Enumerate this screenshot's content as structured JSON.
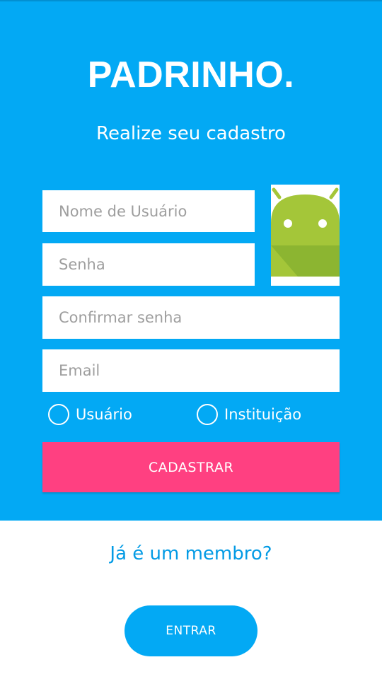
{
  "header": {
    "app_title": "PADRINHO.",
    "subtitle": "Realize seu cadastro"
  },
  "form": {
    "username_placeholder": "Nome de Usuário",
    "password_placeholder": "Senha",
    "confirm_password_placeholder": "Confirmar senha",
    "email_placeholder": "Email",
    "radio_user_label": "Usuário",
    "radio_institution_label": "Instituição",
    "submit_label": "CADASTRAR",
    "avatar_icon": "android-robot-icon"
  },
  "footer": {
    "member_prompt": "Já é um membro?",
    "login_label": "ENTRAR"
  },
  "colors": {
    "primary": "#03a9f4",
    "accent": "#ff4081",
    "link": "#039be5",
    "android_green": "#a4c639"
  }
}
